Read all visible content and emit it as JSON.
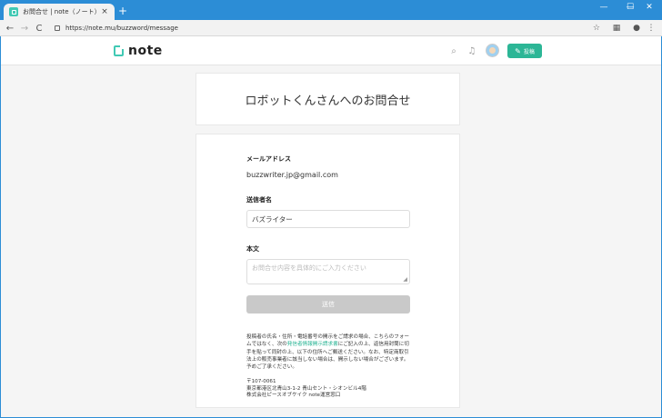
{
  "browser": {
    "tab_title": "お問合せ | note（ノート）",
    "tab_close": "×",
    "new_tab": "+",
    "url": "https://note.mu/buzzword/message",
    "win_min": "—",
    "win_max": "☐",
    "win_close": "✕",
    "back": "←",
    "forward": "→",
    "reload": "C",
    "star": "☆",
    "menu": "⋮"
  },
  "header": {
    "logo_text": "note",
    "post_button": "投稿",
    "search_icon": "search-icon",
    "bell_icon": "bell-icon"
  },
  "page": {
    "title": "ロボットくんさんへのお問合せ"
  },
  "form": {
    "email_label": "メールアドレス",
    "email_value": "buzzwriter.jp@gmail.com",
    "sender_label": "送信者名",
    "sender_value": "バズライター",
    "body_label": "本文",
    "body_placeholder": "お問合せ内容を具体的にご入力ください",
    "submit_label": "送信",
    "notice_pre": "投稿者の氏名・住所・電話番号の開示をご請求の場合、こちらのフォームではなく、次の",
    "notice_link": "発信者情報開示請求書",
    "notice_post": "にご記入の上、返信用封筒に切手を貼って同封の上、以下の住所へご郵送ください。なお、特定商取引法上の販売事業者に該当しない場合は、開示しない場合がございます。予めご了承ください。",
    "address_line1": "〒107-0061",
    "address_line2": "東京都港区北青山3-1-2 青山セント・シオンビル4階",
    "address_line3": "株式会社ピースオブケイク note運営窓口"
  }
}
